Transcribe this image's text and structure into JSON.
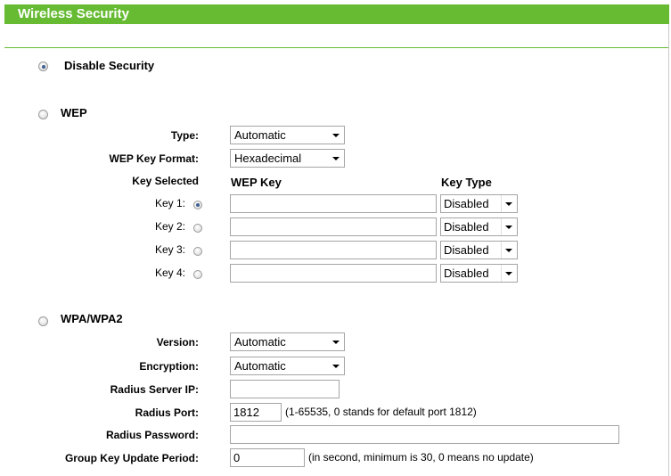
{
  "header": {
    "title": "Wireless Security"
  },
  "disable_security": {
    "label": "Disable Security",
    "selected": true
  },
  "wep": {
    "label": "WEP",
    "selected": false,
    "type_label": "Type:",
    "type_value": "Automatic",
    "key_format_label": "WEP Key Format:",
    "key_format_value": "Hexadecimal",
    "col_key_selected": "Key Selected",
    "col_wep_key": "WEP Key",
    "col_key_type": "Key Type",
    "keys": [
      {
        "label": "Key 1:",
        "selected": true,
        "value": "",
        "type": "Disabled"
      },
      {
        "label": "Key 2:",
        "selected": false,
        "value": "",
        "type": "Disabled"
      },
      {
        "label": "Key 3:",
        "selected": false,
        "value": "",
        "type": "Disabled"
      },
      {
        "label": "Key 4:",
        "selected": false,
        "value": "",
        "type": "Disabled"
      }
    ]
  },
  "wpa": {
    "label": "WPA/WPA2",
    "selected": false,
    "version_label": "Version:",
    "version_value": "Automatic",
    "encryption_label": "Encryption:",
    "encryption_value": "Automatic",
    "radius_ip_label": "Radius Server IP:",
    "radius_ip_value": "",
    "radius_port_label": "Radius Port:",
    "radius_port_value": "1812",
    "radius_port_hint": "(1-65535, 0 stands for default port 1812)",
    "radius_password_label": "Radius Password:",
    "radius_password_value": "",
    "group_key_label": "Group Key Update Period:",
    "group_key_value": "0",
    "group_key_hint": "(in second, minimum is 30, 0 means no update)"
  },
  "colors": {
    "header_bg": "#66bb33",
    "header_text": "#ffffff"
  }
}
